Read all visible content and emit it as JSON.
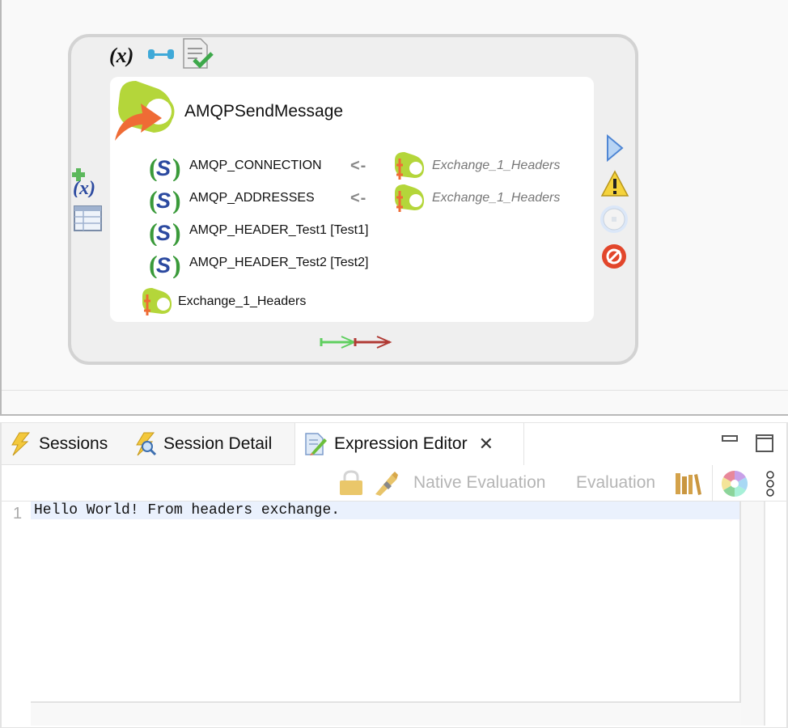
{
  "node": {
    "title": "AMQPSendMessage",
    "toolbar_icons": [
      "variable-icon",
      "link-icon",
      "document-check-icon"
    ],
    "left_icons": [
      "add-variable-icon",
      "table-icon"
    ],
    "right_icons": [
      "play-icon",
      "warning-icon",
      "breakpoint-icon",
      "error-handler-icon"
    ],
    "params": [
      {
        "label": "AMQP_CONNECTION",
        "mapping": "<-",
        "source": "Exchange_1_Headers"
      },
      {
        "label": "AMQP_ADDRESSES",
        "mapping": "<-",
        "source": "Exchange_1_Headers"
      },
      {
        "label": "AMQP_HEADER_Test1 [Test1]",
        "mapping": "",
        "source": ""
      },
      {
        "label": "AMQP_HEADER_Test2 [Test2]",
        "mapping": "",
        "source": ""
      }
    ],
    "output": {
      "label": "Exchange_1_Headers"
    },
    "connectors": [
      "success-connector",
      "error-connector"
    ]
  },
  "panel": {
    "tabs": [
      {
        "label": "Sessions",
        "icon": "lightning-icon",
        "active": false
      },
      {
        "label": "Session Detail",
        "icon": "lightning-search-icon",
        "active": false
      },
      {
        "label": "Expression Editor",
        "icon": "edit-document-icon",
        "active": true
      }
    ],
    "toolbar": {
      "native_evaluation": "Native Evaluation",
      "evaluation": "Evaluation"
    },
    "editor": {
      "line_numbers": [
        "1"
      ],
      "lines": [
        "Hello World! From headers exchange."
      ]
    }
  }
}
